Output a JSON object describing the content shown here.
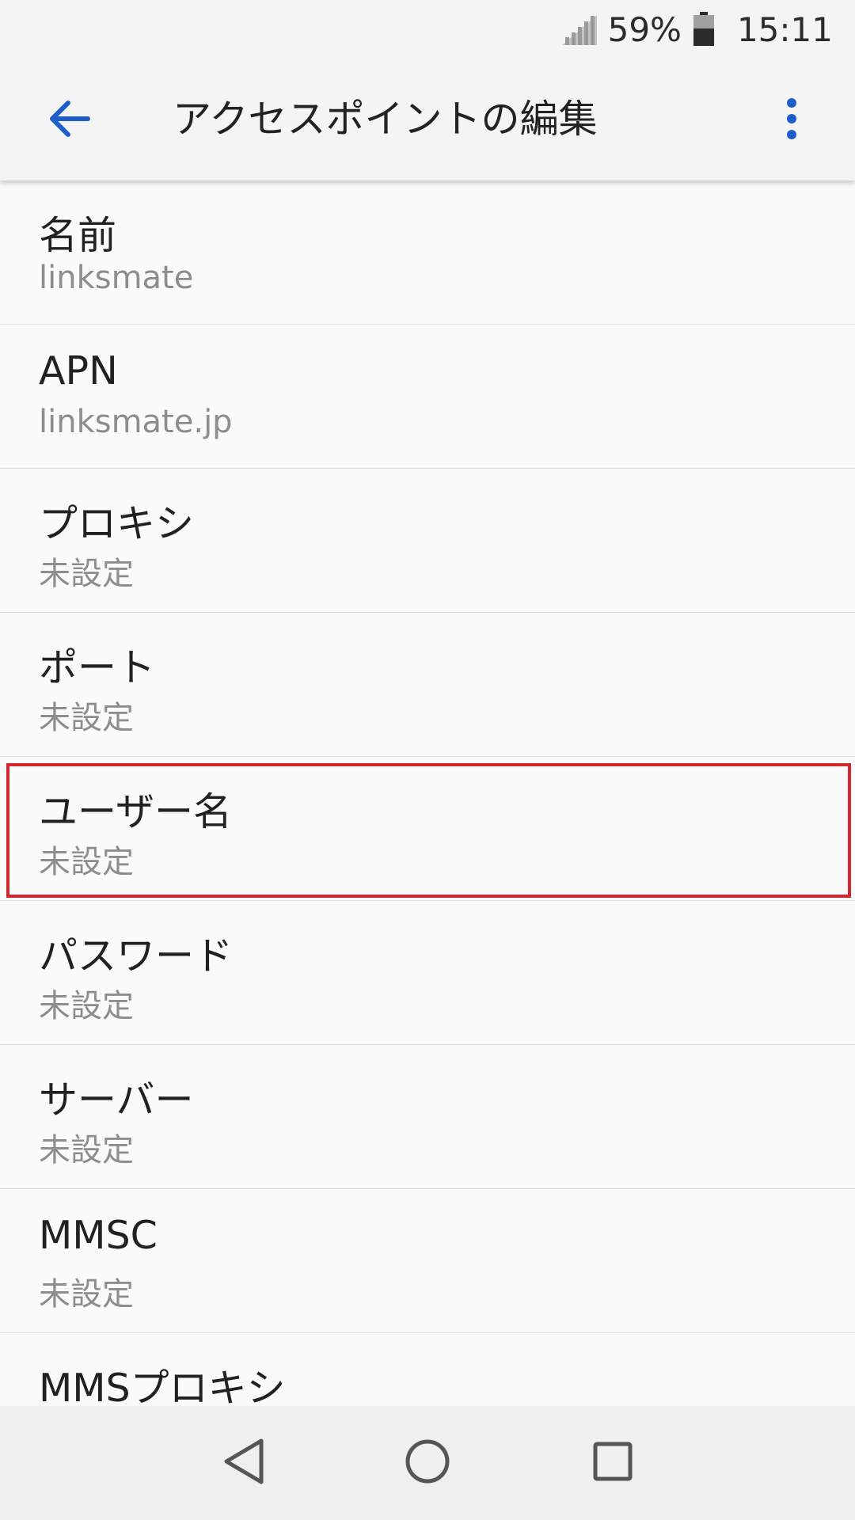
{
  "status_bar": {
    "battery_percent": "59%",
    "time": "15:11",
    "icons": [
      "signal-icon",
      "battery-icon"
    ]
  },
  "app_bar": {
    "title": "アクセスポイントの編集",
    "back_icon": "arrow-back-icon",
    "menu_icon": "more-vert-icon",
    "accent_color": "#1e5ec8"
  },
  "settings": {
    "items": [
      {
        "title": "名前",
        "value": "linksmate"
      },
      {
        "title": "APN",
        "value": "linksmate.jp"
      },
      {
        "title": "プロキシ",
        "value": "未設定"
      },
      {
        "title": "ポート",
        "value": "未設定"
      },
      {
        "title": "ユーザー名",
        "value": "未設定"
      },
      {
        "title": "パスワード",
        "value": "未設定"
      },
      {
        "title": "サーバー",
        "value": "未設定"
      },
      {
        "title": "MMSC",
        "value": "未設定"
      },
      {
        "title": "MMSプロキシ",
        "value": ""
      }
    ],
    "highlight_color": "#d32530"
  },
  "nav_bar": {
    "icons": [
      "nav-back-icon",
      "nav-home-icon",
      "nav-recents-icon"
    ]
  }
}
